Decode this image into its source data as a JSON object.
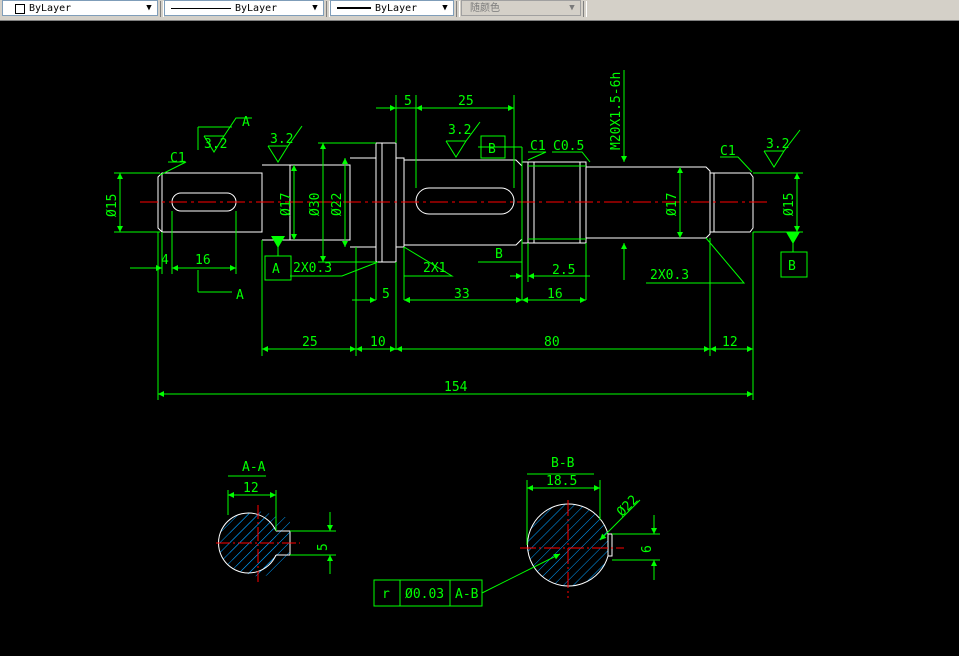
{
  "toolbar": {
    "layer_combo": "ByLayer",
    "linetype_combo": "ByLayer",
    "lineweight_combo": "ByLayer",
    "color_combo": "随颜色",
    "arrow": "▼"
  },
  "drawing": {
    "dims": {
      "d5a": "5",
      "d25a": "25",
      "thread": "M20X1.5-6h",
      "c1_left": "C1",
      "c1_mid": "C1",
      "c05": "C0.5",
      "c1_right": "C1",
      "r32_left": "3.2",
      "r32_mid": "3.2",
      "r32_shoulder": "3.2",
      "r32_right": "3.2",
      "sec_a_top": "A",
      "sec_a_bot": "A",
      "sec_b_top": "B",
      "sec_b_bot": "B",
      "dia15_left": "Ø15",
      "dia17_left": "Ø17",
      "dia30": "Ø30",
      "dia22": "Ø22",
      "dia17_right": "Ø17",
      "dia15_right": "Ø15",
      "datum_a": "A",
      "datum_b": "B",
      "d4": "4",
      "d16a": "16",
      "chamfer_2x03_left": "2X0.3",
      "chamfer_2x1": "2X1",
      "d25": "2.5",
      "chamfer_2x03_right": "2X0.3",
      "d5b": "5",
      "d33": "33",
      "d16b": "16",
      "d25b": "25",
      "d10": "10",
      "d80": "80",
      "d12": "12",
      "d154": "154",
      "section_aa": "A-A",
      "aa_w": "12",
      "aa_h": "5",
      "section_bb": "B-B",
      "bb_w": "18.5",
      "bb_dia": "Ø22",
      "bb_h": "6",
      "tol_sym": "r",
      "tol_val": "Ø0.03",
      "tol_ref": "A-B"
    }
  },
  "colors": {
    "dim_green": "#00ff00",
    "outline_white": "#ffffff",
    "center_red": "#ff0000",
    "hatch_blue": "#00a0ff",
    "background": "#000000"
  }
}
